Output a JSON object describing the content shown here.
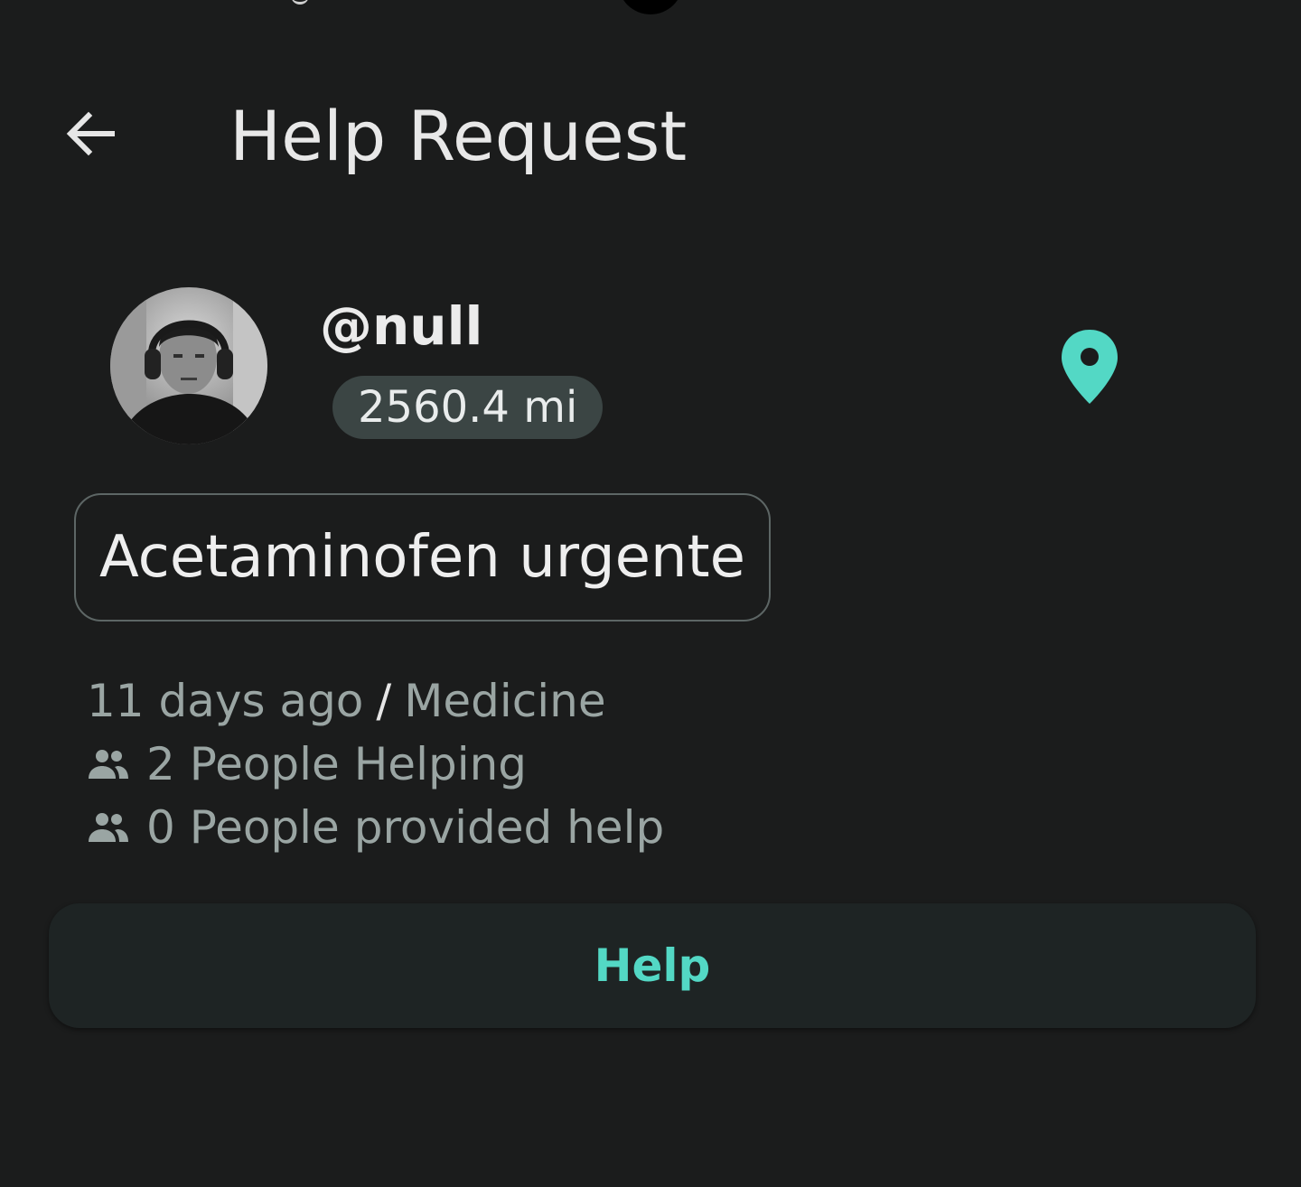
{
  "header": {
    "title": "Help Request",
    "back_icon": "arrow-left-icon"
  },
  "request": {
    "username": "@null",
    "distance": "2560.4 mi",
    "location_icon": "map-pin-icon",
    "title": "Acetaminofen urgente",
    "time_ago": "11 days ago",
    "separator": "/",
    "category": "Medicine",
    "people_helping": "2 People Helping",
    "people_provided_help": "0 People provided help",
    "people_icon": "people-icon"
  },
  "actions": {
    "help_label": "Help"
  },
  "colors": {
    "background": "#1b1c1c",
    "accent": "#53d8c5",
    "chip": "#3b4544",
    "muted_text": "#9aa5a3"
  }
}
